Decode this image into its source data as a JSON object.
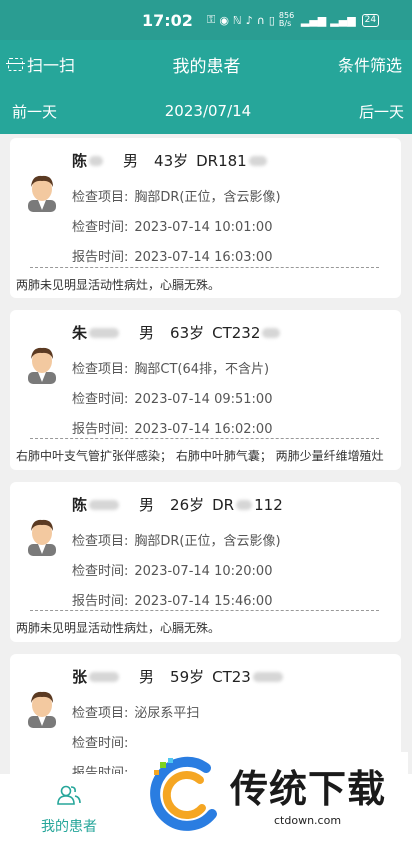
{
  "status_bar": {
    "time": "17:02",
    "net_speed": "856 B/s",
    "battery": "24"
  },
  "header": {
    "scan_label": "扫一扫",
    "title": "我的患者",
    "filter_label": "条件筛选"
  },
  "date_bar": {
    "prev_label": "前一天",
    "date": "2023/07/14",
    "next_label": "后一天"
  },
  "labels": {
    "exam_item": "检查项目:",
    "exam_time": "检查时间:",
    "report_time": "报告时间:"
  },
  "patients": [
    {
      "surname": "陈",
      "gender": "男",
      "age": "43岁",
      "code": "DR181",
      "exam_item": "胸部DR(正位，含云影像)",
      "exam_time": "2023-07-14 10:01:00",
      "report_time": "2023-07-14 16:03:00",
      "result": "两肺未见明显活动性病灶，心膈无殊。"
    },
    {
      "surname": "朱",
      "gender": "男",
      "age": "63岁",
      "code": "CT232",
      "exam_item": "胸部CT(64排，不含片)",
      "exam_time": "2023-07-14 09:51:00",
      "report_time": "2023-07-14 16:02:00",
      "result": "右肺中叶支气管扩张伴感染；  右肺中叶肺气囊；  两肺少量纤维增殖灶"
    },
    {
      "surname": "陈",
      "gender": "男",
      "age": "26岁",
      "code": "DR",
      "code_tail": "112",
      "exam_item": "胸部DR(正位，含云影像)",
      "exam_time": "2023-07-14 10:20:00",
      "report_time": "2023-07-14 15:46:00",
      "result": "两肺未见明显活动性病灶，心膈无殊。"
    },
    {
      "surname": "张",
      "gender": "男",
      "age": "59岁",
      "code": "CT23",
      "exam_item": "泌尿系平扫",
      "exam_time": "",
      "report_time": "",
      "result": ""
    }
  ],
  "bottom_nav": {
    "my_patients_label": "我的患者"
  },
  "watermark": {
    "title": "传统下载",
    "site": "ctdown.com"
  },
  "colors": {
    "primary": "#26a69a",
    "background": "#f0f0f0"
  }
}
